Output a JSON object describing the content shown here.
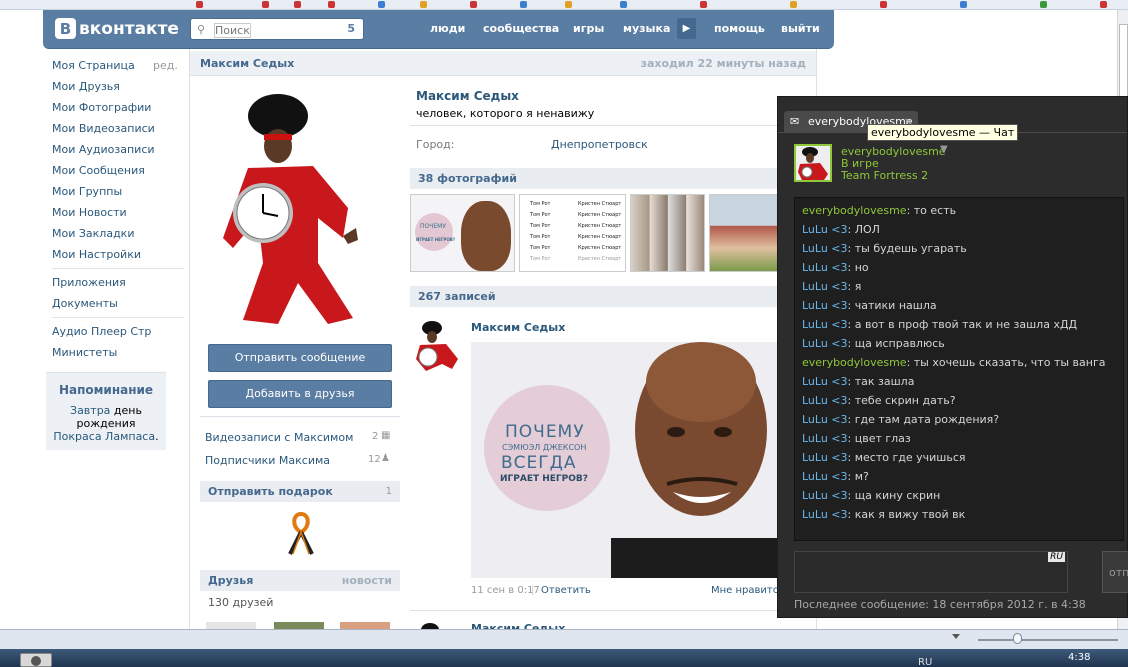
{
  "header": {
    "logo": "вконтакте",
    "logo_letter": "B",
    "search_placeholder": "Поиск",
    "search_count": "5",
    "nav": [
      "люди",
      "сообщества",
      "игры",
      "музыка",
      "помощь",
      "выйти"
    ],
    "play_icon": "play-icon"
  },
  "menu": {
    "items": [
      "Моя Страница",
      "Мои Друзья",
      "Мои Фотографии",
      "Мои Видеозаписи",
      "Мои Аудиозаписи",
      "Мои Сообщения",
      "Мои Группы",
      "Мои Новости",
      "Мои Закладки",
      "Мои Настройки"
    ],
    "edit": "ред.",
    "apps": [
      "Приложения",
      "Документы"
    ],
    "extra": [
      "Аудио Плеер Стр",
      "Министеты"
    ]
  },
  "reminder": {
    "title": "Напоминание",
    "p1": "Завтра",
    "p2": " день рождения ",
    "p3": "Покраса Лампаса",
    "p4": "."
  },
  "profile": {
    "top_name": "Максим Седых",
    "last_seen": "заходил 22 минуты назад",
    "name": "Максим Седых",
    "status": "человек, которого я ненавижу",
    "city_label": "Город:",
    "city": "Днепропетровск",
    "send_message": "Отправить сообщение",
    "add_friend": "Добавить в друзья",
    "videos_label": "Видеозаписи с Максимом",
    "videos_count": "2",
    "subs_label": "Подписчики Максима",
    "subs_count": "12",
    "gift_title": "Отправить подарок",
    "gift_count": "1",
    "friends_title": "Друзья",
    "friends_news": "новости",
    "friends_count": "130 друзей"
  },
  "photos": {
    "title": "38 фотографий",
    "thumb_text1": "ПОЧЕМУ",
    "thumb_text2": "ИГРАЕТ НЕГРОВ?",
    "list_names": [
      "Том Рот",
      "Том Рот",
      "Том Рот",
      "Том Рот",
      "Том Рот",
      "Том Рот"
    ],
    "list_names2": [
      "Кристен Стюарт",
      "Кристен Стюарт",
      "Кристен Стюарт",
      "Кристен Стюарт",
      "Кристен Стюарт",
      "Кристен Стюарт"
    ]
  },
  "wall": {
    "title": "267 записей",
    "post_author": "Максим Седых",
    "poster_l1": "ПОЧЕМУ",
    "poster_l2": "СЭМЮЭЛ ДЖЕКСОН",
    "poster_l3": "ВСЕГДА",
    "poster_l4": "ИГРАЕТ НЕГРОВ?",
    "post_date": "11 сен в 0:17",
    "reply": "Ответить",
    "like": "Мне нравится",
    "next_author": "Максим Седых"
  },
  "steam": {
    "tab": "everybodylovesme",
    "tab_close": "×",
    "tooltip": "everybodylovesme — Чат",
    "friend_name": "everybodylovesme",
    "friend_state": "В игре",
    "friend_game": "Team Fortress 2",
    "messages": [
      {
        "n": "everybodylovesme",
        "t": ": то есть",
        "s": "e"
      },
      {
        "n": "LuLu <3",
        "t": ": ЛОЛ",
        "s": "l"
      },
      {
        "n": "LuLu <3",
        "t": ": ты будешь угарать",
        "s": "l"
      },
      {
        "n": "LuLu <3",
        "t": ": но",
        "s": "l"
      },
      {
        "n": "LuLu <3",
        "t": ": я",
        "s": "l"
      },
      {
        "n": "LuLu <3",
        "t": ": чатики нашла",
        "s": "l"
      },
      {
        "n": "LuLu <3",
        "t": ": а вот в проф твой так и не зашла хДД",
        "s": "l"
      },
      {
        "n": "LuLu <3",
        "t": ": ща исправлюсь",
        "s": "l"
      },
      {
        "n": "everybodylovesme",
        "t": ": ты хочешь сказать, что ты ванга",
        "s": "e"
      },
      {
        "n": "LuLu <3",
        "t": ": так зашла",
        "s": "l"
      },
      {
        "n": "LuLu <3",
        "t": ": тебе скрин дать?",
        "s": "l"
      },
      {
        "n": "LuLu <3",
        "t": ": где там дата рождения?",
        "s": "l"
      },
      {
        "n": "LuLu <3",
        "t": ": цвет глаз",
        "s": "l"
      },
      {
        "n": "LuLu <3",
        "t": ": место где учишься",
        "s": "l"
      },
      {
        "n": "LuLu <3",
        "t": ": м?",
        "s": "l"
      },
      {
        "n": "LuLu <3",
        "t": ": ща кину скрин",
        "s": "l"
      },
      {
        "n": "LuLu <3",
        "t": ": как я вижу твой вк",
        "s": "l"
      }
    ],
    "lang": "RU",
    "send": "отп",
    "last_message": "Последнее сообщение: 18 сентября 2012 г. в 4:38"
  },
  "taskbar": {
    "lang": "RU",
    "time": "4:38"
  }
}
